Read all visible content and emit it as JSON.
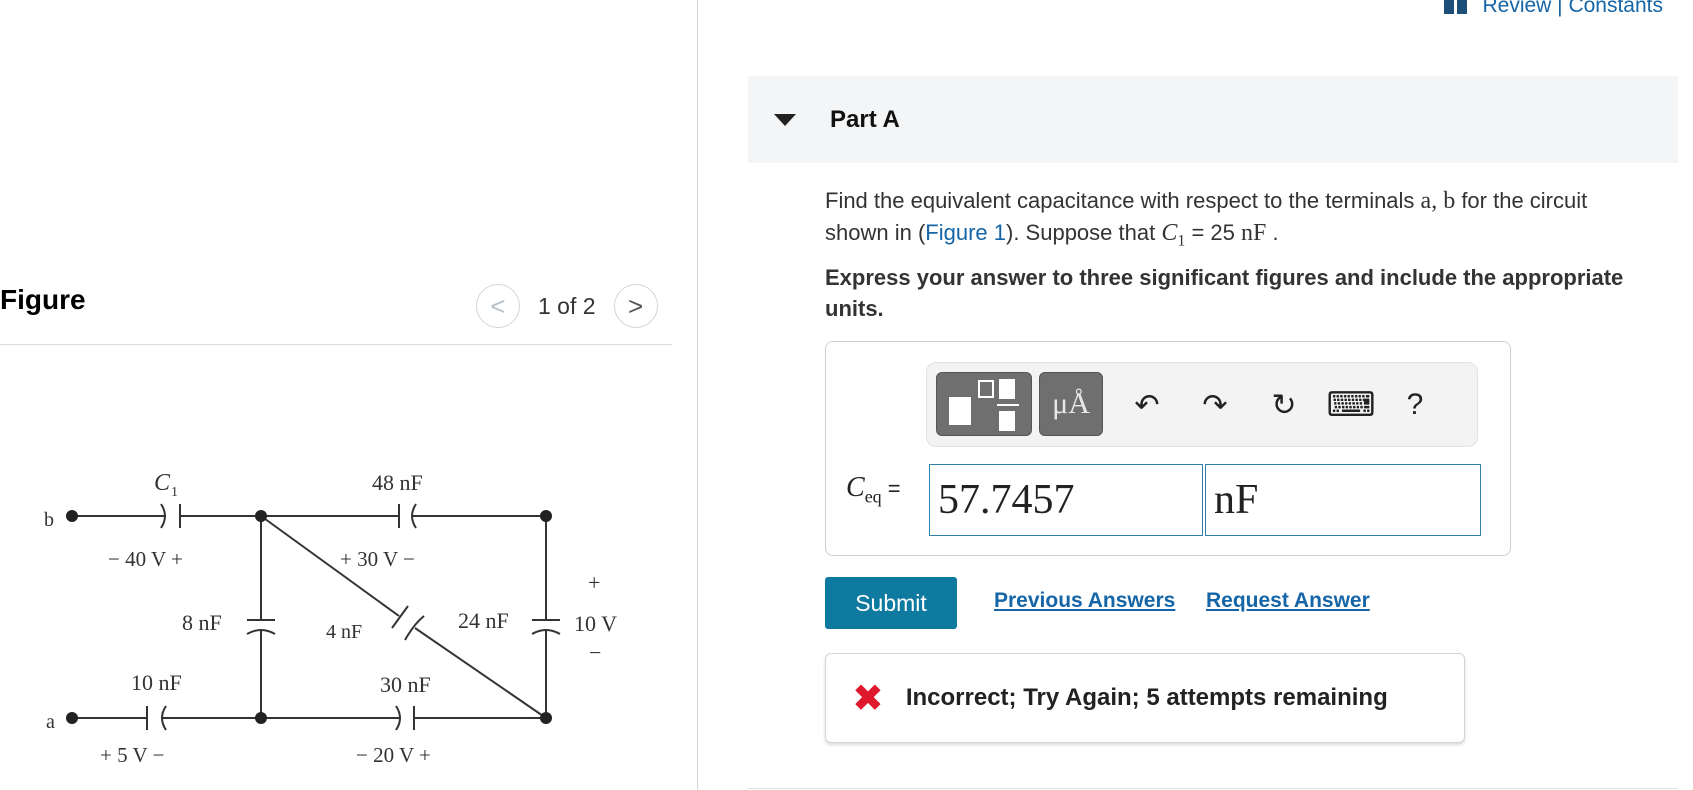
{
  "review": {
    "text": "Review | Constants"
  },
  "figure": {
    "title": "Figure",
    "nav_prev": "<",
    "nav_next": ">",
    "counter": "1 of 2",
    "circuit_labels": {
      "c1": "C",
      "c1_sub": "1",
      "cap_48": "48 nF",
      "v_c1": "− 40 V  +",
      "v_48": "+  30 V  −",
      "cap_8": "8 nF",
      "cap_4": "4 nF",
      "cap_24": "24 nF",
      "v_10": "10 V",
      "plus": "+",
      "minus": "−",
      "cap_10": "10 nF",
      "cap_30": "30 nF",
      "v_5": "+   5 V  −",
      "v_20": "−  20 V  +",
      "node_a": "a",
      "node_b": "b"
    }
  },
  "part": {
    "title": "Part A",
    "question_1": "Find the equivalent capacitance with respect to the terminals ",
    "terminals": "a, b",
    "question_2": " for the circuit shown in (",
    "figure_link": "Figure 1",
    "question_3": "). Suppose that ",
    "c1_sym": "C",
    "c1_sub": "1",
    "question_4": " = 25  ",
    "unit_nf": "nF",
    "question_5": " .",
    "instruction": "Express your answer to three significant figures and include the appropriate units."
  },
  "toolbar": {
    "units_btn": "μÅ",
    "undo": "↶",
    "redo": "↷",
    "reset": "↻",
    "keyboard": "⌨",
    "help": "?"
  },
  "answer": {
    "label_main": "C",
    "label_sub": "eq",
    "label_eq": "=",
    "value": "57.7457",
    "units": "nF"
  },
  "actions": {
    "submit": "Submit",
    "previous_answers": "Previous Answers",
    "request_answer": "Request Answer"
  },
  "feedback": {
    "icon": "✖",
    "text": "Incorrect; Try Again; 5 attempts remaining"
  }
}
